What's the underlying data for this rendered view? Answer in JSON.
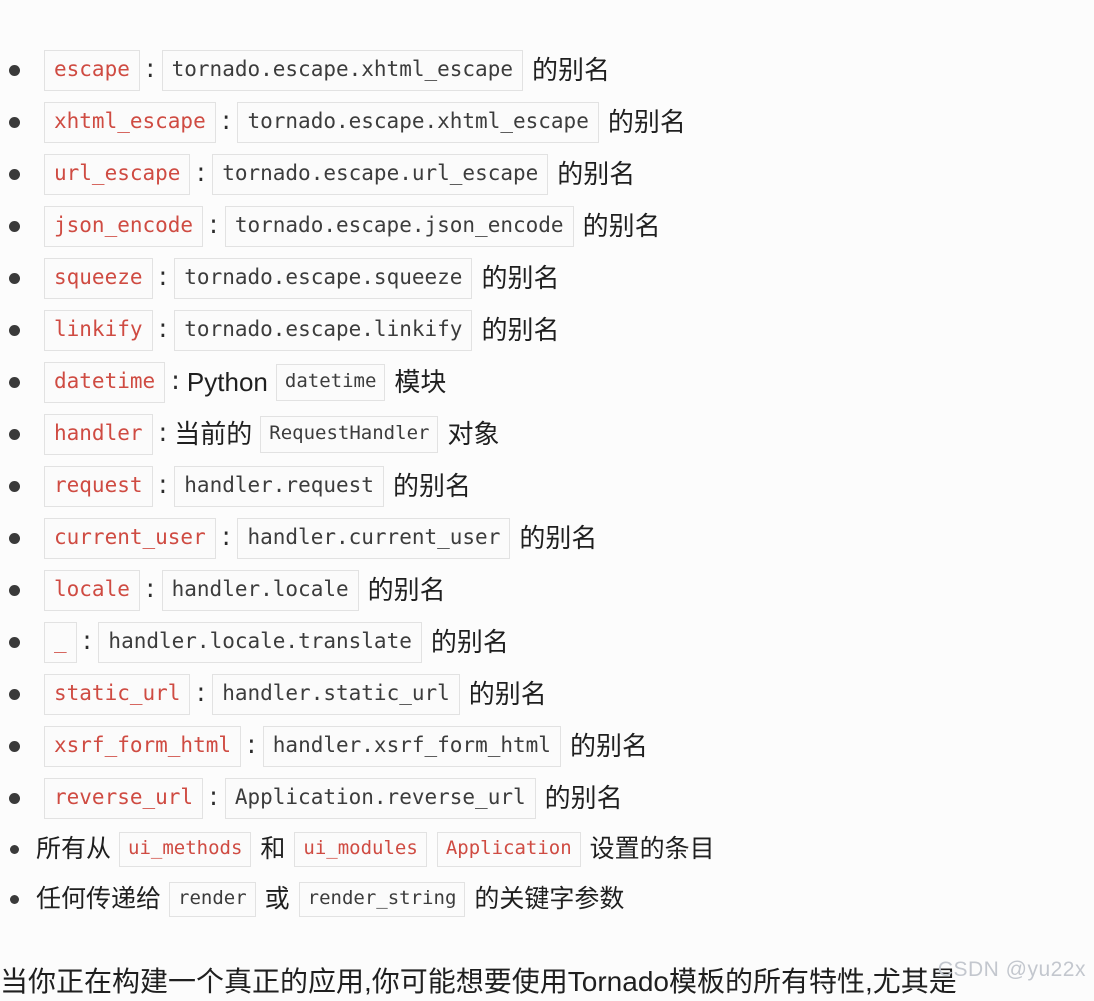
{
  "page": {
    "background": "#fcfcfc",
    "code_red": "#cf4b42",
    "code_dark": "#3c3c3c",
    "code_border": "#e2e2e2",
    "watermark": "CSDN @yu22x"
  },
  "list": {
    "items": [
      {
        "kind": "alias",
        "key": "escape",
        "colon": ":",
        "value": "tornado.escape.xhtml_escape",
        "suffix": "的别名"
      },
      {
        "kind": "alias",
        "key": "xhtml_escape",
        "colon": ":",
        "value": "tornado.escape.xhtml_escape",
        "suffix": "的别名"
      },
      {
        "kind": "alias",
        "key": "url_escape",
        "colon": ":",
        "value": "tornado.escape.url_escape",
        "suffix": "的别名"
      },
      {
        "kind": "alias",
        "key": "json_encode",
        "colon": ":",
        "value": "tornado.escape.json_encode",
        "suffix": "的别名"
      },
      {
        "kind": "alias",
        "key": "squeeze",
        "colon": ":",
        "value": "tornado.escape.squeeze",
        "suffix": "的别名"
      },
      {
        "kind": "alias",
        "key": "linkify",
        "colon": ":",
        "value": "tornado.escape.linkify",
        "suffix": "的别名"
      },
      {
        "kind": "prose",
        "key": "datetime",
        "colon": ":",
        "lead": "Python",
        "value": "datetime",
        "suffix": "模块"
      },
      {
        "kind": "prose",
        "key": "handler",
        "colon": ":",
        "lead": "当前的",
        "value": "RequestHandler",
        "suffix": "对象"
      },
      {
        "kind": "alias",
        "key": "request",
        "colon": ":",
        "value": "handler.request",
        "suffix": "的别名"
      },
      {
        "kind": "alias",
        "key": "current_user",
        "colon": ":",
        "value": "handler.current_user",
        "suffix": "的别名"
      },
      {
        "kind": "alias",
        "key": "locale",
        "colon": ":",
        "value": "handler.locale",
        "suffix": "的别名"
      },
      {
        "kind": "alias",
        "key": "_",
        "colon": ":",
        "value": "handler.locale.translate",
        "suffix": "的别名"
      },
      {
        "kind": "alias",
        "key": "static_url",
        "colon": ":",
        "value": "handler.static_url",
        "suffix": "的别名"
      },
      {
        "kind": "alias",
        "key": "xsrf_form_html",
        "colon": ":",
        "value": "handler.xsrf_form_html",
        "suffix": "的别名"
      },
      {
        "kind": "alias",
        "key": "reverse_url",
        "colon": ":",
        "value": "Application.reverse_url",
        "suffix": "的别名"
      }
    ],
    "ui_settings_item": {
      "lead": "所有从",
      "code_1": "ui_methods",
      "conj": "和",
      "code_2": "ui_modules",
      "code_3": "Application",
      "suffix": "设置的条目"
    },
    "render_kwargs_item": {
      "lead": "任何传递给",
      "code_1": "render",
      "conj": "或",
      "code_2": "render_string",
      "suffix": "的关键字参数"
    }
  },
  "tail_paragraph": "当你正在构建一个真正的应用,你可能想要使用Tornado模板的所有特性,尤其是"
}
